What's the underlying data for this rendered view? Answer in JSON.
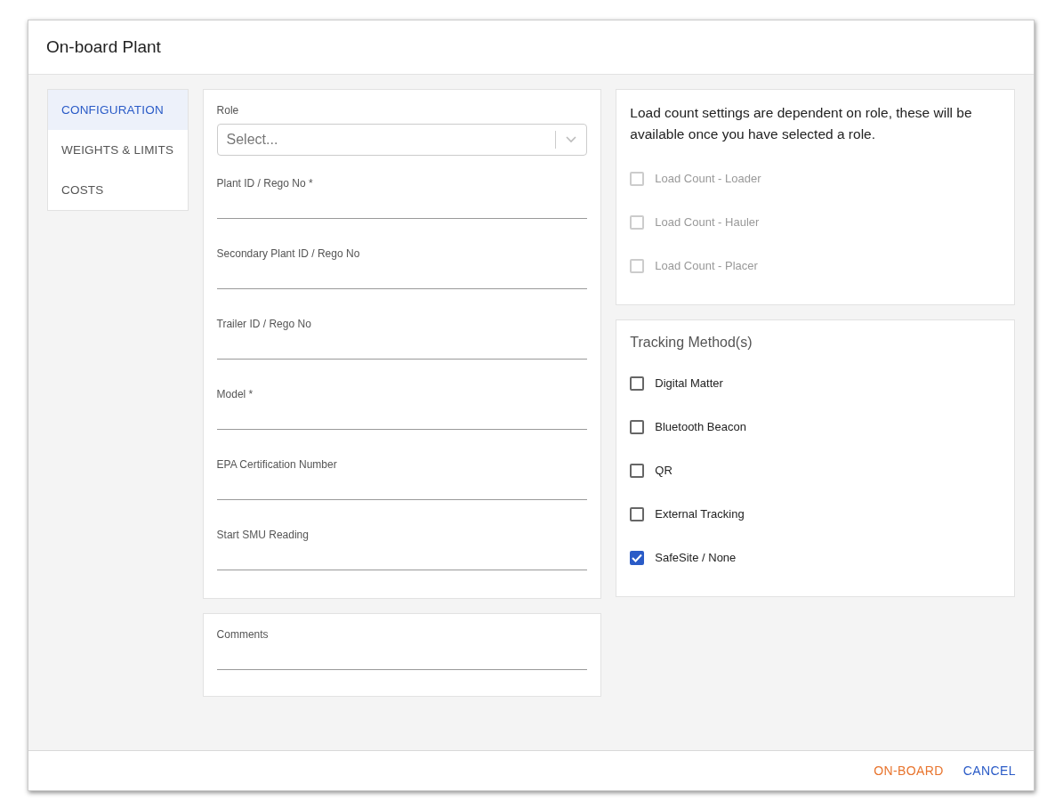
{
  "dialog": {
    "title": "On-board Plant"
  },
  "tabs": [
    {
      "label": "CONFIGURATION",
      "selected": true
    },
    {
      "label": "WEIGHTS & LIMITS",
      "selected": false
    },
    {
      "label": "COSTS",
      "selected": false
    }
  ],
  "role": {
    "label": "Role",
    "placeholder": "Select..."
  },
  "fields": [
    {
      "label": "Plant ID / Rego No *"
    },
    {
      "label": "Secondary Plant ID / Rego No"
    },
    {
      "label": "Trailer ID / Rego No"
    },
    {
      "label": "Model *"
    },
    {
      "label": "EPA Certification Number"
    },
    {
      "label": "Start SMU Reading"
    }
  ],
  "comments": {
    "label": "Comments"
  },
  "load_count": {
    "note": "Load count settings are dependent on role, these will be available once you have selected a role.",
    "options": [
      {
        "label": "Load Count - Loader",
        "checked": false,
        "disabled": true
      },
      {
        "label": "Load Count - Hauler",
        "checked": false,
        "disabled": true
      },
      {
        "label": "Load Count - Placer",
        "checked": false,
        "disabled": true
      }
    ]
  },
  "tracking": {
    "title": "Tracking Method(s)",
    "options": [
      {
        "label": "Digital Matter",
        "checked": false,
        "disabled": false
      },
      {
        "label": "Bluetooth Beacon",
        "checked": false,
        "disabled": false
      },
      {
        "label": "QR",
        "checked": false,
        "disabled": false
      },
      {
        "label": "External Tracking",
        "checked": false,
        "disabled": false
      },
      {
        "label": "SafeSite / None",
        "checked": true,
        "disabled": false
      }
    ]
  },
  "actions": [
    {
      "label": "ON-BOARD",
      "kind": "primary"
    },
    {
      "label": "CANCEL",
      "kind": "secondary"
    }
  ]
}
